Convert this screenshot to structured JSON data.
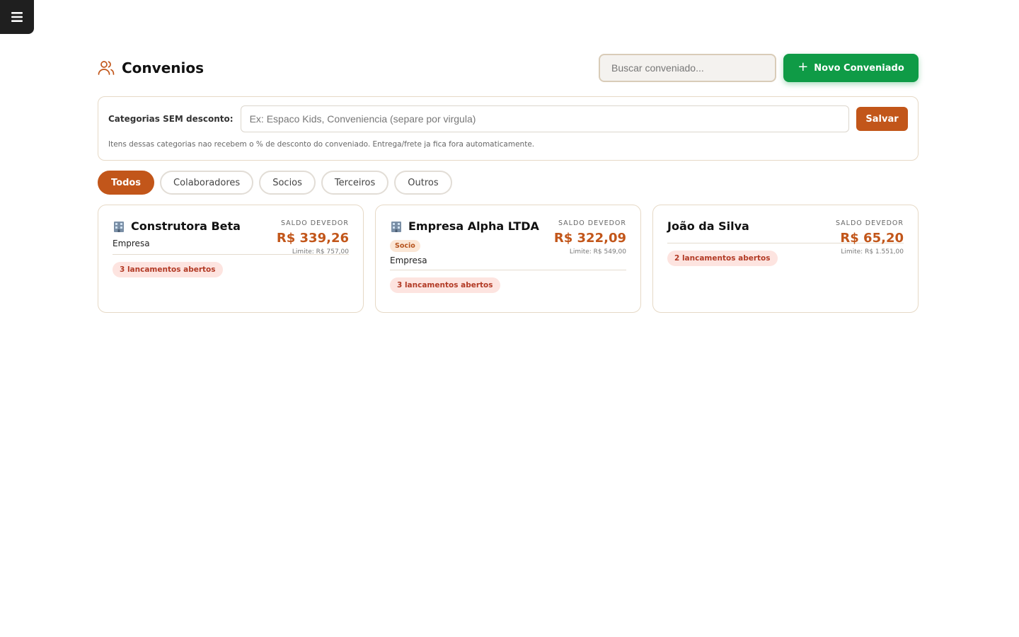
{
  "menu": {
    "icon": "hamburger-menu-icon"
  },
  "header": {
    "title": "Convenios",
    "title_icon": "users-icon",
    "search_placeholder": "Buscar conveniado...",
    "new_button_label": "Novo Conveniado",
    "new_button_icon": "plus-icon"
  },
  "categories": {
    "label": "Categorias SEM desconto:",
    "input_placeholder": "Ex: Espaco Kids, Conveniencia (separe por virgula)",
    "save_label": "Salvar",
    "help_text": "Itens dessas categorias nao recebem o % de desconto do conveniado. Entrega/frete ja fica fora automaticamente."
  },
  "tabs": [
    {
      "label": "Todos",
      "active": true
    },
    {
      "label": "Colaboradores",
      "active": false
    },
    {
      "label": "Socios",
      "active": false
    },
    {
      "label": "Terceiros",
      "active": false
    },
    {
      "label": "Outros",
      "active": false
    }
  ],
  "cards": [
    {
      "name": "Construtora Beta",
      "icon": "building-icon",
      "badge": "",
      "type": "Empresa",
      "saldo_label": "SALDO DEVEDOR",
      "saldo": "R$ 339,26",
      "limite": "Limite: R$ 757,00",
      "lancamentos": "3 lancamentos abertos"
    },
    {
      "name": "Empresa Alpha LTDA",
      "icon": "building-icon",
      "badge": "Socio",
      "type": "Empresa",
      "saldo_label": "SALDO DEVEDOR",
      "saldo": "R$ 322,09",
      "limite": "Limite: R$ 549,00",
      "lancamentos": "3 lancamentos abertos"
    },
    {
      "name": "João da Silva",
      "icon": "",
      "badge": "",
      "type": "",
      "saldo_label": "SALDO DEVEDOR",
      "saldo": "R$ 65,20",
      "limite": "Limite: R$ 1.551,00",
      "lancamentos": "2 lancamentos abertos"
    }
  ],
  "colors": {
    "accent": "#c2561a",
    "success": "#0f9b46",
    "dark": "#1f1f1f"
  }
}
